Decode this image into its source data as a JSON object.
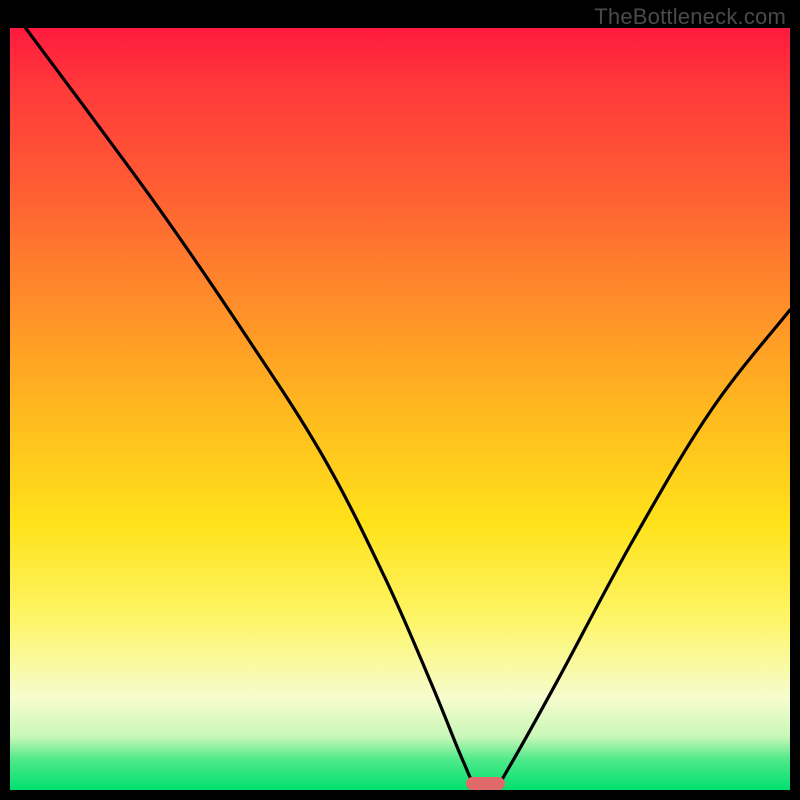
{
  "attribution": "TheBottleneck.com",
  "colors": {
    "frame_bg": "#000000",
    "gradient_stops": [
      "#ff1a3f",
      "#ff3a3a",
      "#ff5a34",
      "#ff8a2a",
      "#ffb81f",
      "#ffe21a",
      "#fdf66a",
      "#f6fccf",
      "#c9f7b8",
      "#4fe98a",
      "#00e070"
    ],
    "curve_stroke": "#000000",
    "marker_fill": "#e06a6a"
  },
  "chart_data": {
    "type": "line",
    "title": "",
    "xlabel": "",
    "ylabel": "",
    "xlim": [
      0,
      100
    ],
    "ylim": [
      0,
      100
    ],
    "grid": false,
    "legend": false,
    "series": [
      {
        "name": "bottleneck-curve",
        "x": [
          2,
          10,
          20,
          30,
          40,
          48,
          54,
          58,
          60,
          62,
          64,
          70,
          80,
          90,
          100
        ],
        "values": [
          100,
          89,
          75,
          60,
          44,
          28,
          14,
          4,
          0,
          0,
          3,
          14,
          33,
          50,
          63
        ]
      }
    ],
    "annotations": [
      {
        "name": "min-marker",
        "x_center": 61,
        "width_pct": 5,
        "y": 0
      }
    ]
  }
}
